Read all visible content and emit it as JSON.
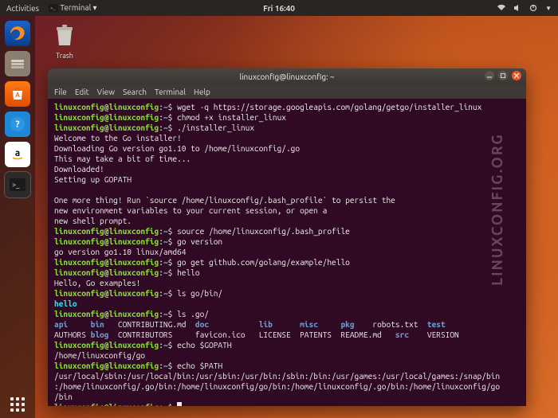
{
  "topbar": {
    "activities": "Activities",
    "app_indicator": "Terminal ▾",
    "clock": "Fri 16:40"
  },
  "desktop": {
    "trash_label": "Trash"
  },
  "watermark": "LINUXCONFIG.ORG",
  "dock": {
    "items": [
      {
        "name": "firefox",
        "bg": "linear-gradient(#1b63c7,#0a3e8b)",
        "glyph_svg": "ff"
      },
      {
        "name": "files",
        "bg": "#6f6257",
        "glyph_svg": "files"
      },
      {
        "name": "software",
        "bg": "linear-gradient(#ff7a18,#e04e00)",
        "glyph_svg": "bag"
      },
      {
        "name": "help",
        "bg": "#1e87d6",
        "glyph_svg": "qmark"
      },
      {
        "name": "amazon",
        "bg": "#ffffff",
        "glyph_svg": "amazon"
      },
      {
        "name": "terminal",
        "bg": "#2d2a28",
        "glyph_svg": "term"
      }
    ]
  },
  "terminal": {
    "title": "linuxconfig@linuxconfig: ~",
    "menus": [
      "File",
      "Edit",
      "View",
      "Search",
      "Terminal",
      "Help"
    ],
    "prompt_user": "linuxconfig@linuxconfig",
    "prompt_path": "~",
    "lines": {
      "cmd_wget": "wget -q https://storage.googleapis.com/golang/getgo/installer_linux",
      "cmd_chmod": "chmod +x installer_linux",
      "cmd_run": "./installer_linux",
      "out_welcome": "Welcome to the Go installer!",
      "out_dl": "Downloading Go version go1.10 to /home/linuxconfig/.go",
      "out_wait": "This may take a bit of time...",
      "out_done": "Downloaded!",
      "out_gopath": "Setting up GOPATH",
      "out_more1": "One more thing! Run `source /home/linuxconfig/.bash_profile` to persist the",
      "out_more2": "new environment variables to your current session, or open a",
      "out_more3": "new shell prompt.",
      "cmd_source": "source /home/linuxconfig/.bash_profile",
      "cmd_gover": "go version",
      "out_gover": "go version go1.10 linux/amd64",
      "cmd_goget": "go get github.com/golang/example/hello",
      "cmd_hello": "hello",
      "out_hello": "Hello, Go examples!",
      "cmd_ls_gobin": "ls go/bin/",
      "out_ls_gobin": "hello",
      "cmd_ls_go": "ls .go/",
      "ls_row1": {
        "api": "api",
        "bin": "bin",
        "contributing": "CONTRIBUTING.md",
        "doc": "doc",
        "lib": "lib",
        "misc": "misc",
        "pkg": "pkg",
        "robots": "robots.txt",
        "test": "test"
      },
      "ls_row2": {
        "authors": "AUTHORS",
        "blog": "blog",
        "contributors": "CONTRIBUTORS",
        "favicon": "favicon.ico",
        "license": "LICENSE",
        "patents": "PATENTS",
        "readme": "README.md",
        "src": "src",
        "version": "VERSION"
      },
      "cmd_echo_gopath": "echo $GOPATH",
      "out_echo_gopath": "/home/linuxconfig/go",
      "cmd_echo_path": "echo $PATH",
      "out_echo_path1": "/usr/local/sbin:/usr/local/bin:/usr/sbin:/usr/bin:/sbin:/bin:/usr/games:/usr/local/games:/snap/bin",
      "out_echo_path2": ":/home/linuxconfig/.go/bin:/home/linuxconfig/go/bin:/home/linuxconfig/.go/bin:/home/linuxconfig/go",
      "out_echo_path3": "/bin"
    }
  }
}
